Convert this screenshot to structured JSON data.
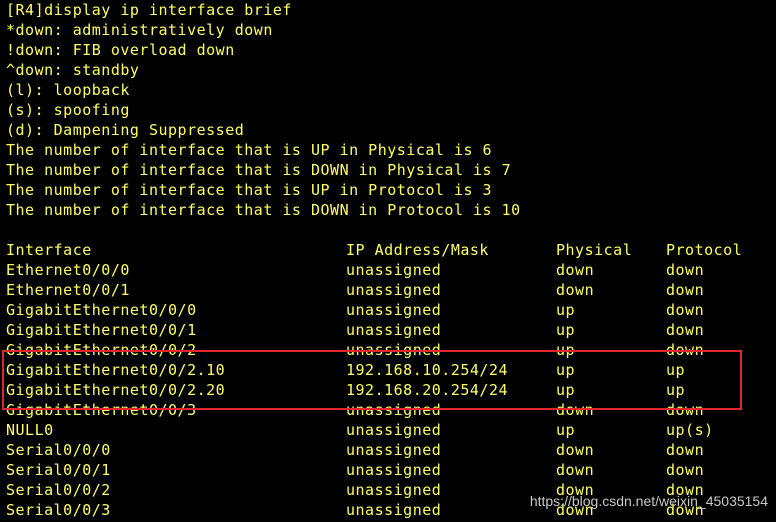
{
  "terminal": {
    "lines": [
      "[R4]display ip interface brief",
      "*down: administratively down",
      "!down: FIB overload down",
      "^down: standby",
      "(l): loopback",
      "(s): spoofing",
      "(d): Dampening Suppressed",
      "The number of interface that is UP in Physical is 6",
      "The number of interface that is DOWN in Physical is 7",
      "The number of interface that is UP in Protocol is 3",
      "The number of interface that is DOWN in Protocol is 10"
    ],
    "table": {
      "headers": [
        "Interface",
        "IP Address/Mask",
        "Physical",
        "Protocol"
      ],
      "rows": [
        [
          "Ethernet0/0/0",
          "unassigned",
          "down",
          "down"
        ],
        [
          "Ethernet0/0/1",
          "unassigned",
          "down",
          "down"
        ],
        [
          "GigabitEthernet0/0/0",
          "unassigned",
          "up",
          "down"
        ],
        [
          "GigabitEthernet0/0/1",
          "unassigned",
          "up",
          "down"
        ],
        [
          "GigabitEthernet0/0/2",
          "unassigned",
          "up",
          "down"
        ],
        [
          "GigabitEthernet0/0/2.10",
          "192.168.10.254/24",
          "up",
          "up"
        ],
        [
          "GigabitEthernet0/0/2.20",
          "192.168.20.254/24",
          "up",
          "up"
        ],
        [
          "GigabitEthernet0/0/3",
          "unassigned",
          "down",
          "down"
        ],
        [
          "NULL0",
          "unassigned",
          "up",
          "up(s)"
        ],
        [
          "Serial0/0/0",
          "unassigned",
          "down",
          "down"
        ],
        [
          "Serial0/0/1",
          "unassigned",
          "down",
          "down"
        ],
        [
          "Serial0/0/2",
          "unassigned",
          "down",
          "down"
        ],
        [
          "Serial0/0/3",
          "unassigned",
          "down",
          "down"
        ]
      ]
    }
  },
  "watermark": "https://blog.csdn.net/weixin_45035154",
  "colors": {
    "background": "#000000",
    "text": "#ffff66",
    "highlight": "#e3262b"
  }
}
